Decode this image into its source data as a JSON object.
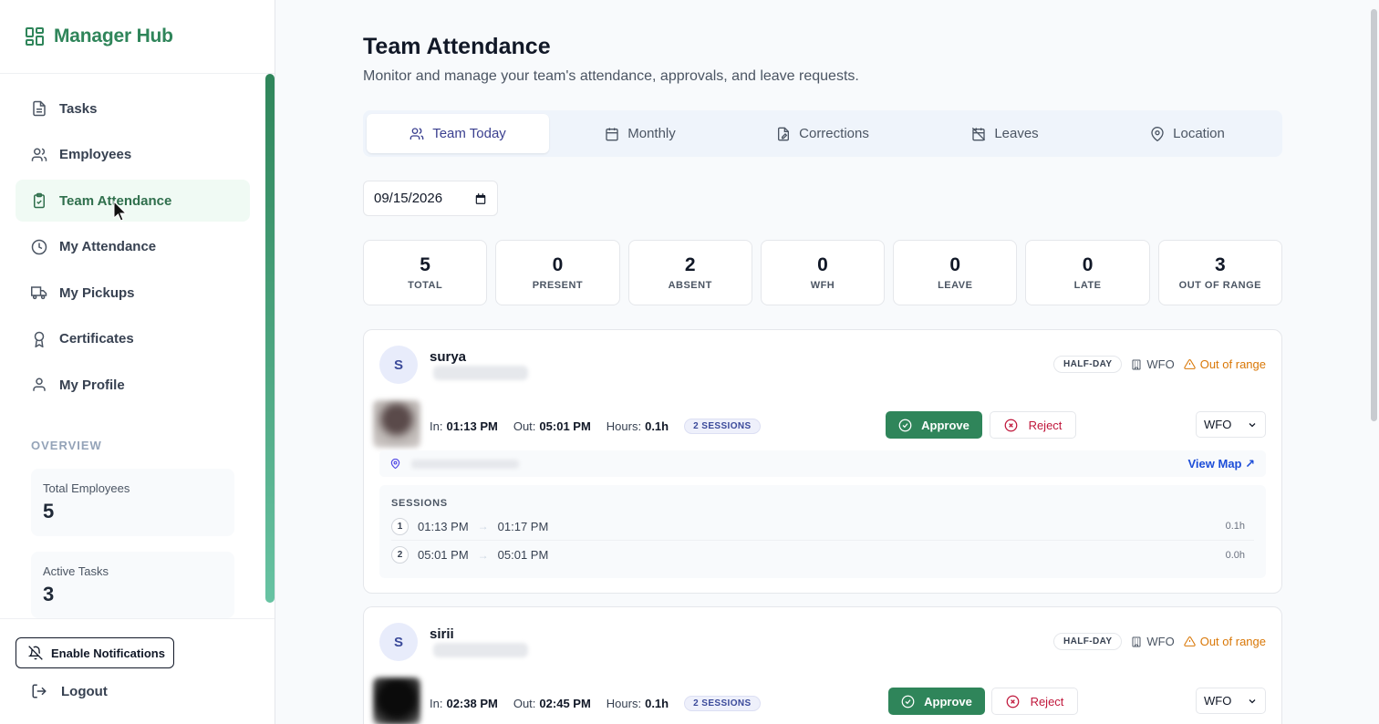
{
  "brand": {
    "title": "Manager Hub"
  },
  "nav": {
    "tasks": "Tasks",
    "employees": "Employees",
    "team_attendance": "Team Attendance",
    "my_attendance": "My Attendance",
    "my_pickups": "My Pickups",
    "certificates": "Certificates",
    "my_profile": "My Profile"
  },
  "overview": {
    "label": "OVERVIEW",
    "total_employees_label": "Total Employees",
    "total_employees_value": "5",
    "active_tasks_label": "Active Tasks",
    "active_tasks_value": "3"
  },
  "footer": {
    "notifications": "Enable Notifications",
    "logout": "Logout"
  },
  "page": {
    "title": "Team Attendance",
    "subtitle": "Monitor and manage your team's attendance, approvals, and leave requests."
  },
  "tabs": {
    "team_today": "Team Today",
    "monthly": "Monthly",
    "corrections": "Corrections",
    "leaves": "Leaves",
    "location": "Location"
  },
  "date": {
    "value": "09/15/2026"
  },
  "summary": [
    {
      "num": "5",
      "cap": "TOTAL"
    },
    {
      "num": "0",
      "cap": "PRESENT"
    },
    {
      "num": "2",
      "cap": "ABSENT"
    },
    {
      "num": "0",
      "cap": "WFH"
    },
    {
      "num": "0",
      "cap": "LEAVE"
    },
    {
      "num": "0",
      "cap": "LATE"
    },
    {
      "num": "3",
      "cap": "OUT OF RANGE"
    }
  ],
  "labels": {
    "in": "In:",
    "out": "Out:",
    "hours": "Hours:",
    "approve": "Approve",
    "reject": "Reject",
    "view_map": "View Map ↗",
    "sessions": "SESSIONS"
  },
  "employees": [
    {
      "initial": "S",
      "name": "surya",
      "status": "HALF-DAY",
      "mode": "WFO",
      "range": "Out of range",
      "in": "01:13 PM",
      "out": "05:01 PM",
      "hours": "0.1h",
      "sessions_count": "2 SESSIONS",
      "select": "WFO",
      "sessions": [
        {
          "n": "1",
          "start": "01:13 PM",
          "end": "01:17 PM",
          "hrs": "0.1h"
        },
        {
          "n": "2",
          "start": "05:01 PM",
          "end": "05:01 PM",
          "hrs": "0.0h"
        }
      ]
    },
    {
      "initial": "S",
      "name": "sirii",
      "status": "HALF-DAY",
      "mode": "WFO",
      "range": "Out of range",
      "in": "02:38 PM",
      "out": "02:45 PM",
      "hours": "0.1h",
      "sessions_count": "2 SESSIONS",
      "select": "WFO"
    }
  ],
  "colors": {
    "brand_green": "#2f855a",
    "reject_red": "#c0183c",
    "warning_amber": "#d97706",
    "link_blue": "#1d4ed8"
  }
}
